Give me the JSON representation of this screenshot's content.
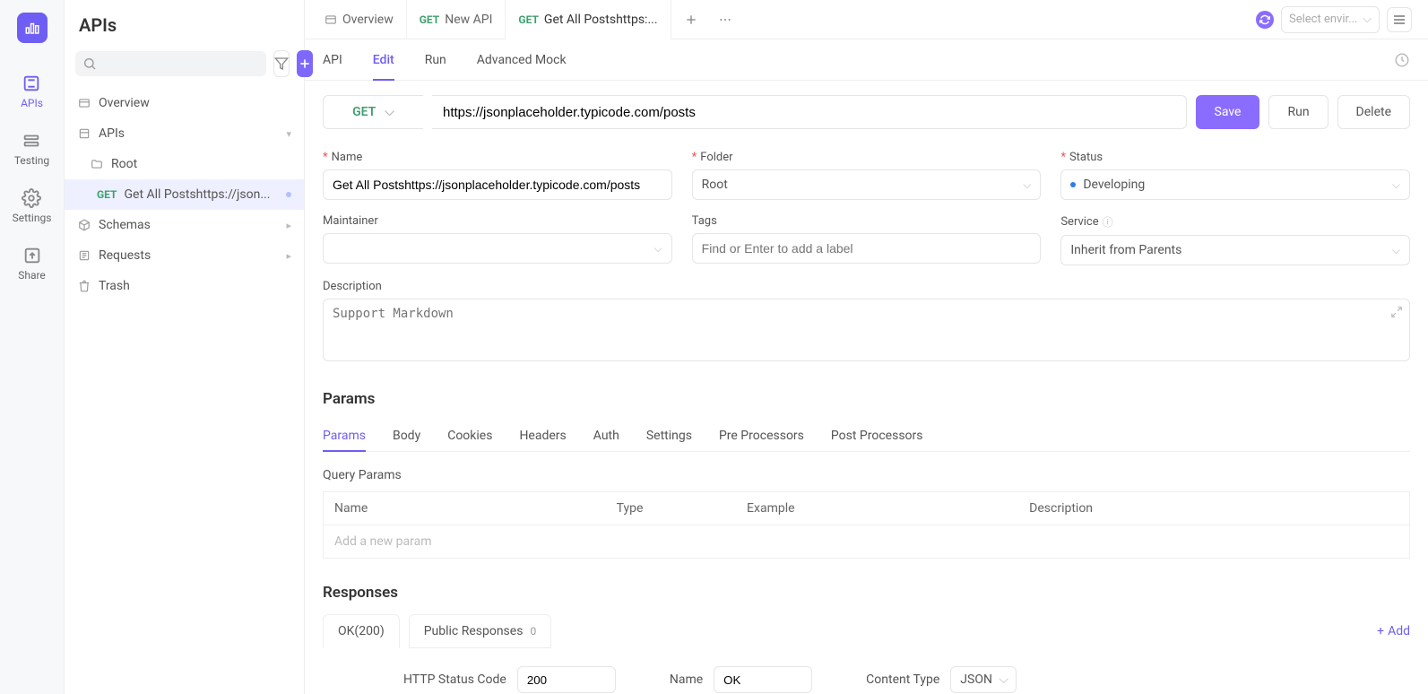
{
  "app": {
    "title": "APIs"
  },
  "iconSidebar": {
    "items": [
      {
        "label": "APIs"
      },
      {
        "label": "Testing"
      },
      {
        "label": "Settings"
      },
      {
        "label": "Share"
      }
    ]
  },
  "tree": {
    "overview": "Overview",
    "apis": "APIs",
    "rootFolder": "Root",
    "request": {
      "method": "GET",
      "name": "Get All Postshttps://json..."
    },
    "schemas": "Schemas",
    "requests": "Requests",
    "trash": "Trash",
    "searchPlaceholder": ""
  },
  "tabs": {
    "overview": "Overview",
    "newApi": {
      "method": "GET",
      "label": "New API"
    },
    "current": {
      "method": "GET",
      "label": "Get All Postshttps:..."
    }
  },
  "envSelect": "Select envir...",
  "subTabs": {
    "api": "API",
    "edit": "Edit",
    "run": "Run",
    "mock": "Advanced Mock"
  },
  "urlBar": {
    "method": "GET",
    "url": "https://jsonplaceholder.typicode.com/posts"
  },
  "actions": {
    "save": "Save",
    "run": "Run",
    "delete": "Delete"
  },
  "form": {
    "nameLabel": "Name",
    "nameValue": "Get All Postshttps://jsonplaceholder.typicode.com/posts",
    "folderLabel": "Folder",
    "folderValue": "Root",
    "statusLabel": "Status",
    "statusValue": "Developing",
    "maintainerLabel": "Maintainer",
    "maintainerValue": "",
    "tagsLabel": "Tags",
    "tagsPlaceholder": "Find or Enter to add a label",
    "serviceLabel": "Service",
    "serviceValue": "Inherit from Parents",
    "descLabel": "Description",
    "descPlaceholder": "Support Markdown"
  },
  "params": {
    "title": "Params",
    "tabs": [
      "Params",
      "Body",
      "Cookies",
      "Headers",
      "Auth",
      "Settings",
      "Pre Processors",
      "Post Processors"
    ],
    "querySection": "Query Params",
    "columns": {
      "name": "Name",
      "type": "Type",
      "example": "Example",
      "description": "Description"
    },
    "addPlaceholder": "Add a new param"
  },
  "responses": {
    "title": "Responses",
    "tabs": {
      "ok": "OK(200)",
      "public": "Public Responses",
      "publicCount": "0"
    },
    "add": "Add",
    "meta": {
      "codeLabel": "HTTP Status Code",
      "codeValue": "200",
      "nameLabel": "Name",
      "nameValue": "OK",
      "ctLabel": "Content Type",
      "ctValue": "JSON"
    }
  }
}
